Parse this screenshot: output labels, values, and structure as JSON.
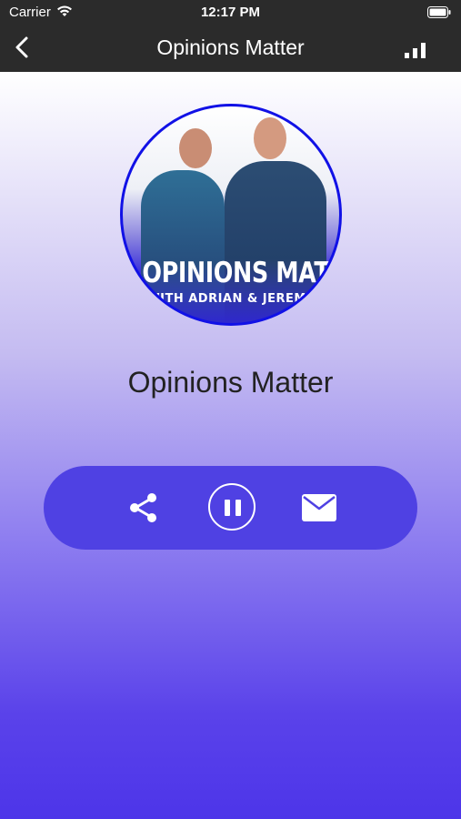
{
  "status_bar": {
    "carrier": "Carrier",
    "time": "12:17 PM"
  },
  "nav": {
    "title": "Opinions Matter"
  },
  "artwork": {
    "title_text": "OPINIONS MATTER",
    "subtitle_text": "WITH ADRIAN & JEREMY"
  },
  "station": {
    "title": "Opinions Matter"
  },
  "controls": {
    "share_icon": "share-icon",
    "pause_icon": "pause-icon",
    "mail_icon": "mail-icon"
  },
  "colors": {
    "nav_background": "#2b2b2b",
    "control_bar": "#4f41e3",
    "artwork_border": "#1111e6"
  }
}
